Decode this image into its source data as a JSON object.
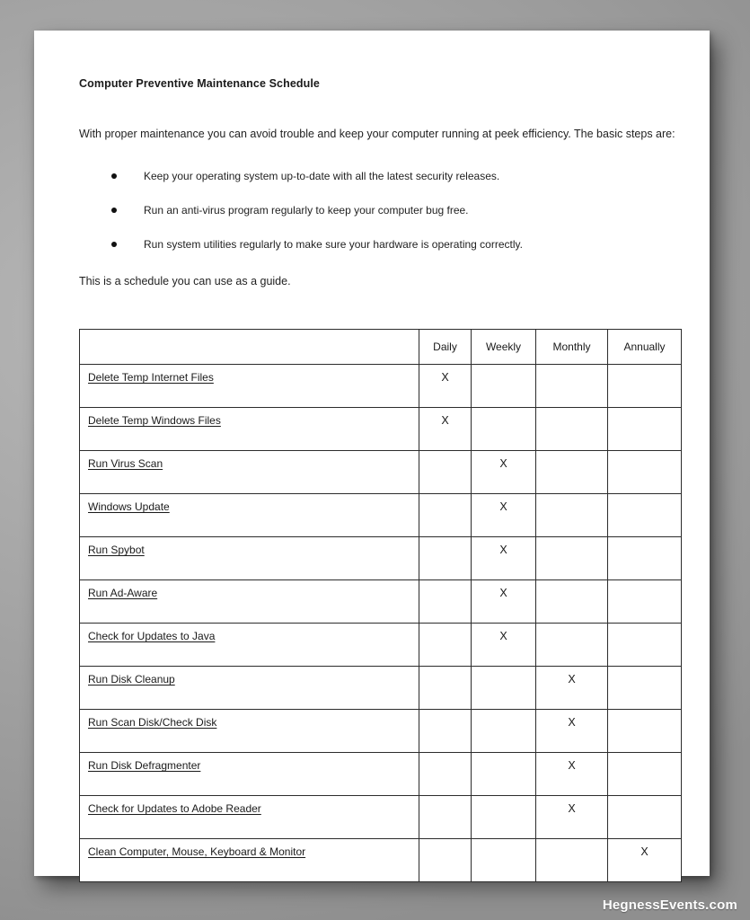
{
  "document": {
    "title": "Computer Preventive Maintenance Schedule",
    "intro": "With proper maintenance you can avoid trouble and keep your computer running at peek efficiency. The basic steps are:",
    "bullets": [
      "Keep your operating system up-to-date with all the latest security releases.",
      "Run an anti-virus program  regularly to keep your computer bug free.",
      "Run system utilities regularly to make sure your hardware is operating correctly."
    ],
    "guide_line": "This is a schedule you can use as a guide.",
    "table": {
      "headers": [
        "",
        "Daily",
        "Weekly",
        "Monthly",
        "Annually"
      ],
      "mark": "X",
      "rows": [
        {
          "task": "Delete Temp Internet Files",
          "daily": "X",
          "weekly": "",
          "monthly": "",
          "annually": ""
        },
        {
          "task": "Delete Temp Windows Files",
          "daily": "X",
          "weekly": "",
          "monthly": "",
          "annually": ""
        },
        {
          "task": "Run Virus Scan",
          "daily": "",
          "weekly": "X",
          "monthly": "",
          "annually": ""
        },
        {
          "task": "Windows Update",
          "daily": "",
          "weekly": "X",
          "monthly": "",
          "annually": ""
        },
        {
          "task": "Run Spybot",
          "daily": "",
          "weekly": "X",
          "monthly": "",
          "annually": ""
        },
        {
          "task": "Run Ad-Aware",
          "daily": "",
          "weekly": "X",
          "monthly": "",
          "annually": ""
        },
        {
          "task": "Check for Updates to Java",
          "daily": "",
          "weekly": "X",
          "monthly": "",
          "annually": ""
        },
        {
          "task": "Run Disk Cleanup",
          "daily": "",
          "weekly": "",
          "monthly": "X",
          "annually": ""
        },
        {
          "task": "Run Scan Disk/Check Disk",
          "daily": "",
          "weekly": "",
          "monthly": "X",
          "annually": ""
        },
        {
          "task": "Run Disk Defragmenter",
          "daily": "",
          "weekly": "",
          "monthly": "X",
          "annually": ""
        },
        {
          "task": "Check for Updates to Adobe Reader",
          "daily": "",
          "weekly": "",
          "monthly": "X",
          "annually": ""
        },
        {
          "task": "Clean Computer, Mouse, Keyboard & Monitor",
          "daily": "",
          "weekly": "",
          "monthly": "",
          "annually": "X"
        }
      ]
    }
  },
  "watermark": {
    "text": "HegnessEvents.com"
  }
}
